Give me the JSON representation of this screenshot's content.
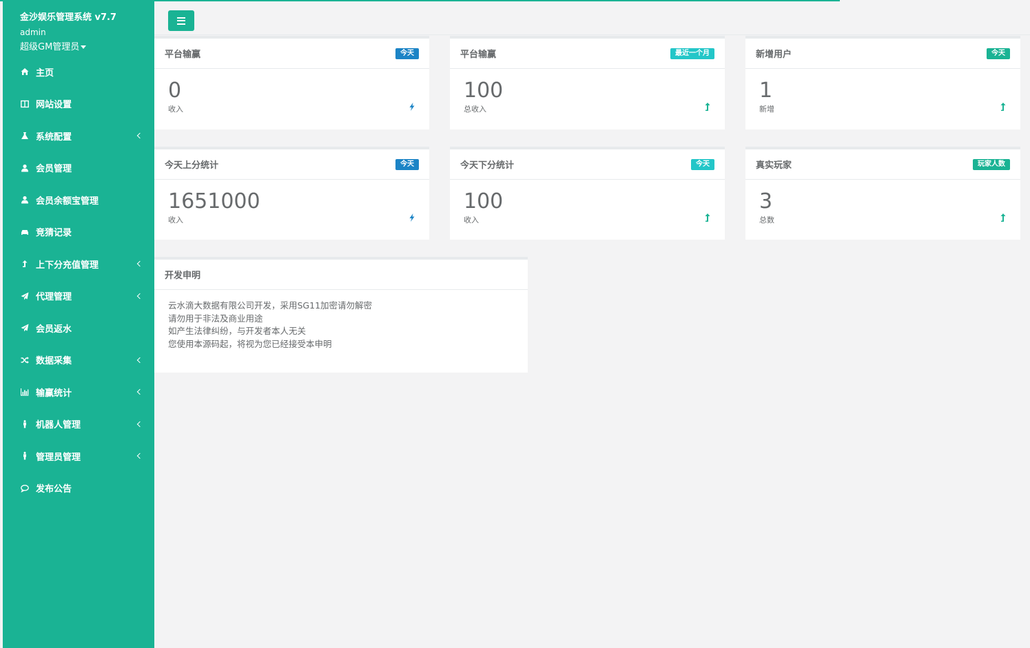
{
  "app": {
    "title": "金沙娱乐管理系统 v7.7",
    "user_name": "admin",
    "user_role": "超级GM管理员"
  },
  "sidebar": {
    "items": [
      {
        "label": "主页",
        "icon": "home-icon",
        "has_submenu": false
      },
      {
        "label": "网站设置",
        "icon": "columns-icon",
        "has_submenu": false
      },
      {
        "label": "系统配置",
        "icon": "flask-icon",
        "has_submenu": true
      },
      {
        "label": "会员管理",
        "icon": "user-icon",
        "has_submenu": false
      },
      {
        "label": "会员余额宝管理",
        "icon": "user-icon",
        "has_submenu": false
      },
      {
        "label": "竞猜记录",
        "icon": "car-icon",
        "has_submenu": false
      },
      {
        "label": "上下分充值管理",
        "icon": "level-up-icon",
        "has_submenu": true
      },
      {
        "label": "代理管理",
        "icon": "paper-plane-icon",
        "has_submenu": true
      },
      {
        "label": "会员返水",
        "icon": "paper-plane-icon",
        "has_submenu": false
      },
      {
        "label": "数据采集",
        "icon": "random-icon",
        "has_submenu": true
      },
      {
        "label": "输赢统计",
        "icon": "bar-chart-icon",
        "has_submenu": true
      },
      {
        "label": "机器人管理",
        "icon": "male-icon",
        "has_submenu": true
      },
      {
        "label": "管理员管理",
        "icon": "male-icon",
        "has_submenu": true
      },
      {
        "label": "发布公告",
        "icon": "comments-icon",
        "has_submenu": false
      }
    ]
  },
  "colors": {
    "primary": "#1ab394",
    "success_badge": "#1c84c6",
    "info_badge": "#23c6c8",
    "text": "#676a6c",
    "bolt_icon": "#1c84c6",
    "arrow_icon": "#1ab394"
  },
  "stats": [
    {
      "title": "平台输赢",
      "badge": "今天",
      "badge_color": "#1c84c6",
      "value": "0",
      "label": "收入",
      "icon": "bolt-icon"
    },
    {
      "title": "平台输赢",
      "badge": "最近一个月",
      "badge_color": "#23c6c8",
      "value": "100",
      "label": "总收入",
      "icon": "level-up-icon"
    },
    {
      "title": "新增用户",
      "badge": "今天",
      "badge_color": "#1ab394",
      "value": "1",
      "label": "新增",
      "icon": "level-up-icon"
    },
    {
      "title": "今天上分统计",
      "badge": "今天",
      "badge_color": "#1c84c6",
      "value": "1651000",
      "label": "收入",
      "icon": "bolt-icon"
    },
    {
      "title": "今天下分统计",
      "badge": "今天",
      "badge_color": "#23c6c8",
      "value": "100",
      "label": "收入",
      "icon": "level-up-icon"
    },
    {
      "title": "真实玩家",
      "badge": "玩家人数",
      "badge_color": "#1ab394",
      "value": "3",
      "label": "总数",
      "icon": "level-up-icon"
    }
  ],
  "notice": {
    "title": "开发申明",
    "lines": [
      "云水滴大数据有限公司开发，采用SG11加密请勿解密",
      "请勿用于非法及商业用途",
      "如产生法律纠纷，与开发者本人无关",
      "您使用本源码起，将视为您已经接受本申明"
    ]
  }
}
